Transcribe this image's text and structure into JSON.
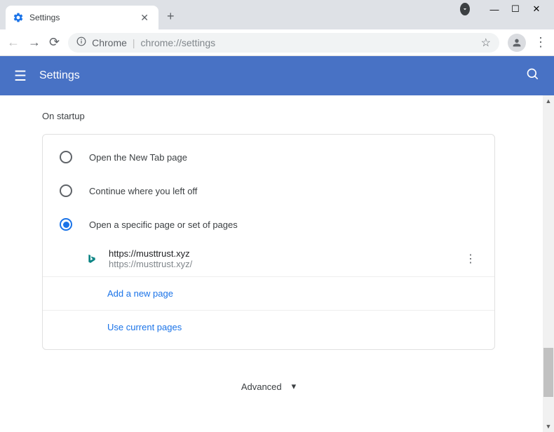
{
  "window": {
    "tab_title": "Settings"
  },
  "toolbar": {
    "chrome_label": "Chrome",
    "url": "chrome://settings"
  },
  "header": {
    "title": "Settings"
  },
  "section": {
    "title": "On startup",
    "options": [
      {
        "label": "Open the New Tab page"
      },
      {
        "label": "Continue where you left off"
      },
      {
        "label": "Open a specific page or set of pages"
      }
    ],
    "page_entry": {
      "title": "https://musttrust.xyz",
      "url": "https://musttrust.xyz/"
    },
    "add_page_label": "Add a new page",
    "use_current_label": "Use current pages"
  },
  "advanced_label": "Advanced"
}
